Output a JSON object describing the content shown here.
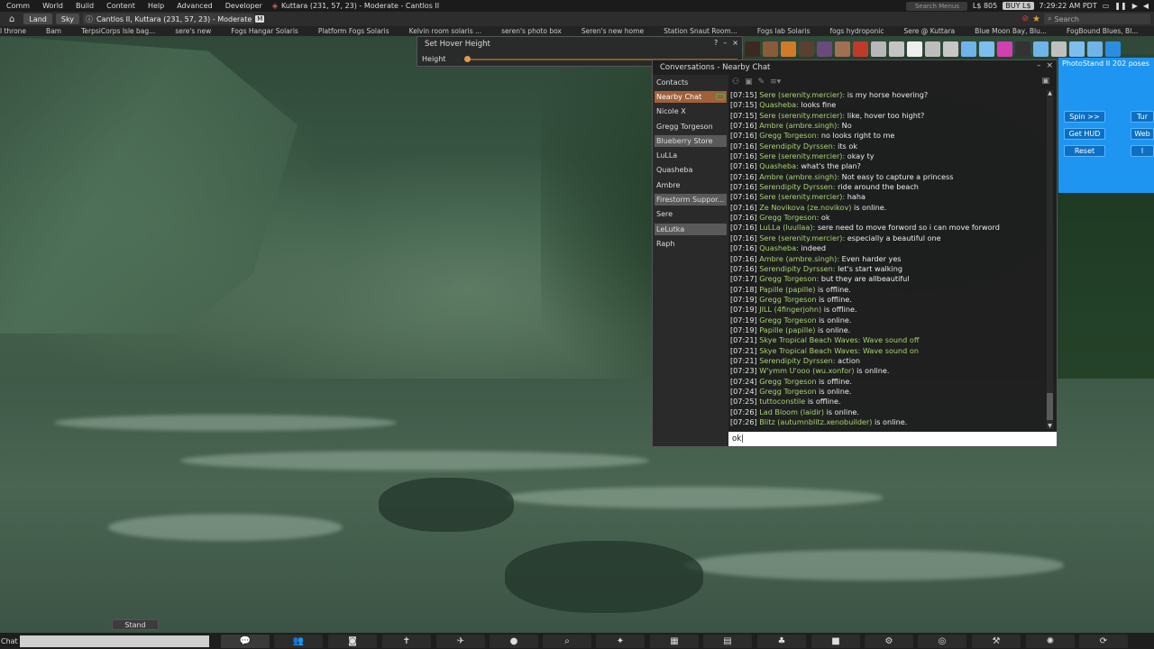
{
  "menu": {
    "items": [
      "Comm",
      "World",
      "Build",
      "Content",
      "Help",
      "Advanced",
      "Developer"
    ],
    "location": "Kuttara (231, 57, 23) - Moderate - Cantlos II",
    "search_placeholder": "Search Menus",
    "balance": "L$ 805",
    "buy_label": "BUY L$",
    "time": "7:29:22 AM PDT"
  },
  "nav": {
    "land_label": "Land",
    "sky_label": "Sky",
    "location": "Cantlos II, Kuttara (231, 57, 23) - Moderate",
    "maturity_badge": "M",
    "search_placeholder": "Search"
  },
  "favorites": [
    "l throne",
    "Bam",
    "TerpsiCorps Isle bag...",
    "sere's new",
    "Fogs Hangar Solaris",
    "Platform Fogs Solaris",
    "Kelvin room solaris ...",
    "seren's photo box",
    "Seren's new home",
    "Station Snaut Room...",
    "Fogs lab Solaris",
    "fogs hydroponic",
    "Sere @ Kuttara",
    "Blue Moon Bay, Blu...",
    "FogBound Blues, Bl..."
  ],
  "hover": {
    "title": "Set Hover Height",
    "help": "?",
    "minimize": "–",
    "close": "×",
    "label": "Height"
  },
  "hud": {
    "caption": "PhotoStand II 202 poses",
    "spin": "Spin >>",
    "get_hud": "Get HUD",
    "reset": "Reset",
    "turn": "Tur",
    "web": "Web",
    "misc": "l"
  },
  "conversations": {
    "title": "Conversations - Nearby Chat",
    "minimize": "–",
    "close": "×",
    "contacts": [
      {
        "label": "Contacts",
        "state": "normal"
      },
      {
        "label": "Nearby Chat",
        "state": "active"
      },
      {
        "label": "Nicole X",
        "state": "normal"
      },
      {
        "label": "Gregg Torgeson",
        "state": "normal"
      },
      {
        "label": "Blueberry Store",
        "state": "hl"
      },
      {
        "label": "LuLLa",
        "state": "normal"
      },
      {
        "label": "Quasheba",
        "state": "normal"
      },
      {
        "label": "Ambre",
        "state": "normal"
      },
      {
        "label": "Firestorm Suppor...",
        "state": "hl"
      },
      {
        "label": "Sere",
        "state": "normal"
      },
      {
        "label": "LeLutka",
        "state": "hl"
      },
      {
        "label": "Raph",
        "state": "normal"
      }
    ],
    "messages": [
      {
        "t": "[07:15]",
        "n": "Sere (serenity.mercier):",
        "m": "is my horse hovering?"
      },
      {
        "t": "[07:15]",
        "n": "Quasheba:",
        "m": "looks fine"
      },
      {
        "t": "[07:15]",
        "n": "Sere (serenity.mercier):",
        "m": "like, hover too hight?"
      },
      {
        "t": "[07:16]",
        "n": "Ambre (ambre.singh):",
        "m": "No"
      },
      {
        "t": "[07:16]",
        "n": "Gregg Torgeson:",
        "m": "no looks right to me"
      },
      {
        "t": "[07:16]",
        "n": "Serendipity Dyrssen:",
        "m": "its ok"
      },
      {
        "t": "[07:16]",
        "n": "Sere (serenity.mercier):",
        "m": "okay ty"
      },
      {
        "t": "[07:16]",
        "n": "Quasheba:",
        "m": "what's the plan?"
      },
      {
        "t": "[07:16]",
        "n": "Ambre (ambre.singh):",
        "m": "Not easy to capture a princess"
      },
      {
        "t": "[07:16]",
        "n": "Serendipity Dyrssen:",
        "m": "ride around the beach"
      },
      {
        "t": "[07:16]",
        "n": "Sere (serenity.mercier):",
        "m": "haha"
      },
      {
        "t": "[07:16]",
        "n": "Ze Novikova (ze.novikov)",
        "m": "is online."
      },
      {
        "t": "[07:16]",
        "n": "Gregg Torgeson:",
        "m": "ok"
      },
      {
        "t": "[07:16]",
        "n": "LuLLa (luullaa):",
        "m": "sere need to move forword so i can move forword"
      },
      {
        "t": "[07:16]",
        "n": "Sere (serenity.mercier):",
        "m": "especially a beautiful one"
      },
      {
        "t": "[07:16]",
        "n": "Quasheba:",
        "m": "indeed"
      },
      {
        "t": "[07:16]",
        "n": "Ambre (ambre.singh):",
        "m": "Even harder yes"
      },
      {
        "t": "[07:16]",
        "n": "Serendipity Dyrssen:",
        "m": "let's start walking"
      },
      {
        "t": "[07:17]",
        "n": "Gregg Torgeson:",
        "m": "but they are allbeautiful"
      },
      {
        "t": "[07:18]",
        "n": "Papille (papille)",
        "m": "is offline."
      },
      {
        "t": "[07:19]",
        "n": "Gregg Torgeson",
        "m": "is offline."
      },
      {
        "t": "[07:19]",
        "n": "JILL (4fingerjohn)",
        "m": "is offline."
      },
      {
        "t": "[07:19]",
        "n": "Gregg Torgeson",
        "m": "is online."
      },
      {
        "t": "[07:19]",
        "n": "Papille (papille)",
        "m": "is online."
      },
      {
        "t": "[07:21]",
        "n": "Skye Tropical Beach Waves: Wave sound off",
        "m": ""
      },
      {
        "t": "[07:21]",
        "n": "Skye Tropical Beach Waves: Wave sound on",
        "m": ""
      },
      {
        "t": "[07:21]",
        "n": "Serendipity Dyrssen:",
        "m": "action"
      },
      {
        "t": "[07:23]",
        "n": "W'ymm U'ooo (wu.xonfor)",
        "m": "is online."
      },
      {
        "t": "[07:24]",
        "n": "Gregg Torgeson",
        "m": "is offline."
      },
      {
        "t": "[07:24]",
        "n": "Gregg Torgeson",
        "m": "is online."
      },
      {
        "t": "[07:25]",
        "n": "tuttoconstile",
        "m": "is offline."
      },
      {
        "t": "[07:26]",
        "n": "Lad Bloom (laidir)",
        "m": "is online."
      },
      {
        "t": "[07:26]",
        "n": "Blitz (autumnblitz.xenobuilder)",
        "m": "is online."
      }
    ],
    "input_value": "ok"
  },
  "stand_label": "Stand",
  "bottom": {
    "chat_label": "Chat"
  },
  "colors": {
    "name_green": "#a8d36f",
    "active_tab": "#a0603a",
    "hud_blue": "#1e95f0"
  }
}
